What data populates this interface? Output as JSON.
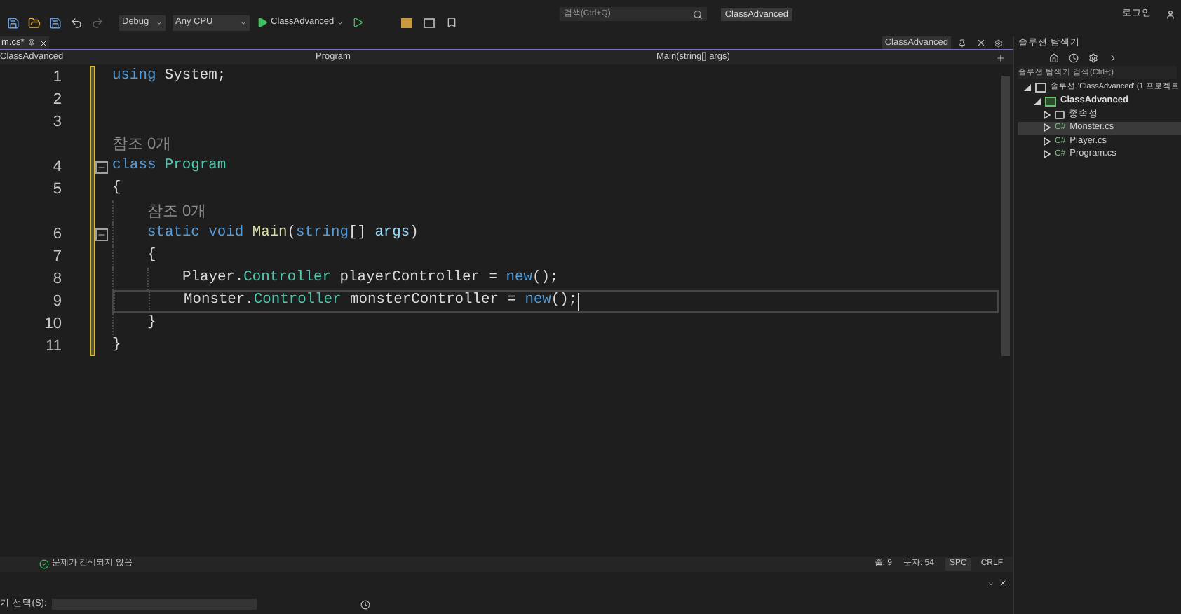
{
  "toolbar": {
    "configuration": "Debug",
    "platform": "Any CPU",
    "start_target": "ClassAdvanced",
    "search": {
      "placeholder": "검색(Ctrl+Q)"
    },
    "solution_badge": "ClassAdvanced",
    "account": "로그인"
  },
  "editor_tabs": [
    {
      "label": "m.cs*",
      "selected": true
    }
  ],
  "tool_window_title": "ClassAdvanced",
  "navigation": {
    "project": "ClassAdvanced",
    "type": "Program",
    "member": "Main(string[] args)"
  },
  "code_lines": [
    {
      "kind": "code",
      "number": "1",
      "current": false,
      "fold": false,
      "tokens": [
        {
          "kind": "keyword",
          "text": "using "
        },
        {
          "kind": "plain",
          "text": "System;"
        }
      ]
    },
    {
      "kind": "code",
      "number": "2",
      "current": false,
      "fold": false
    },
    {
      "kind": "code",
      "number": "3",
      "current": false,
      "fold": false
    },
    {
      "kind": "lens",
      "text": "참조 0개"
    },
    {
      "kind": "code",
      "number": "4",
      "current": false,
      "fold": true,
      "tokens": [
        {
          "kind": "keyword",
          "text": "class "
        },
        {
          "kind": "type",
          "text": "Program"
        }
      ]
    },
    {
      "kind": "code",
      "number": "5",
      "current": false,
      "fold": false,
      "tokens": [
        {
          "kind": "plain",
          "text": "{"
        }
      ]
    },
    {
      "kind": "block",
      "children": [
        {
          "kind": "lens",
          "text": "참조 0개"
        },
        {
          "kind": "code",
          "number": "6",
          "current": false,
          "fold": true,
          "tokens": [
            {
              "kind": "keyword",
              "text": "static "
            },
            {
              "kind": "keyword",
              "text": "void "
            },
            {
              "kind": "method",
              "text": "Main"
            },
            {
              "kind": "plain",
              "text": "("
            },
            {
              "kind": "keyword",
              "text": "string"
            },
            {
              "kind": "plain",
              "text": "[] "
            },
            {
              "kind": "param",
              "text": "args"
            },
            {
              "kind": "plain",
              "text": ")"
            }
          ]
        },
        {
          "kind": "code",
          "number": "7",
          "current": false,
          "fold": false,
          "tokens": [
            {
              "kind": "plain",
              "text": "{"
            }
          ]
        },
        {
          "kind": "block",
          "children": [
            {
              "kind": "code",
              "number": "8",
              "current": false,
              "fold": false,
              "tokens": [
                {
                  "kind": "plain",
                  "text": "Player."
                },
                {
                  "kind": "type",
                  "text": "Controller"
                },
                {
                  "kind": "plain",
                  "text": " playerController = "
                },
                {
                  "kind": "keyword",
                  "text": "new"
                },
                {
                  "kind": "plain",
                  "text": "();"
                }
              ]
            },
            {
              "kind": "code",
              "number": "9",
              "current": true,
              "fold": false,
              "tokens": [
                {
                  "kind": "plain",
                  "text": "Monster."
                },
                {
                  "kind": "type",
                  "text": "Controller"
                },
                {
                  "kind": "plain",
                  "text": " monsterController = "
                },
                {
                  "kind": "keyword",
                  "text": "new"
                },
                {
                  "kind": "plain",
                  "text": "();"
                }
              ]
            }
          ]
        },
        {
          "kind": "code",
          "number": "10",
          "current": false,
          "fold": false,
          "tokens": [
            {
              "kind": "plain",
              "text": "}"
            }
          ]
        }
      ]
    },
    {
      "kind": "code",
      "number": "11",
      "current": false,
      "fold": false,
      "tokens": [
        {
          "kind": "plain",
          "text": "}"
        }
      ]
    }
  ],
  "status_bar": {
    "issues": "문제가 검색되지 않음",
    "line": "줄: 9",
    "column": "문자: 54",
    "whitespace": "SPC",
    "line_ending": "CRLF"
  },
  "output_panel": {
    "source_label": "기 선택(S):"
  },
  "solution_explorer": {
    "title": "솔루션 탐색기",
    "search": {
      "placeholder": "솔루션 탐색기 검색(Ctrl+;)"
    },
    "tree": [
      {
        "label": "솔루션 'ClassAdvanced' (1 프로젝트",
        "kind": "solution",
        "expanded": true,
        "selected": false,
        "children": [
          {
            "label": "ClassAdvanced",
            "kind": "project",
            "expanded": true,
            "selected": false,
            "children": [
              {
                "label": "종속성",
                "kind": "dependencies",
                "expanded": false,
                "selected": false
              },
              {
                "label": "Monster.cs",
                "kind": "csharp",
                "badge": "C#",
                "expanded": false,
                "selected": true
              },
              {
                "label": "Player.cs",
                "kind": "csharp",
                "badge": "C#",
                "expanded": false,
                "selected": false
              },
              {
                "label": "Program.cs",
                "kind": "csharp",
                "badge": "C#",
                "expanded": false,
                "selected": false
              }
            ]
          }
        ]
      }
    ]
  }
}
